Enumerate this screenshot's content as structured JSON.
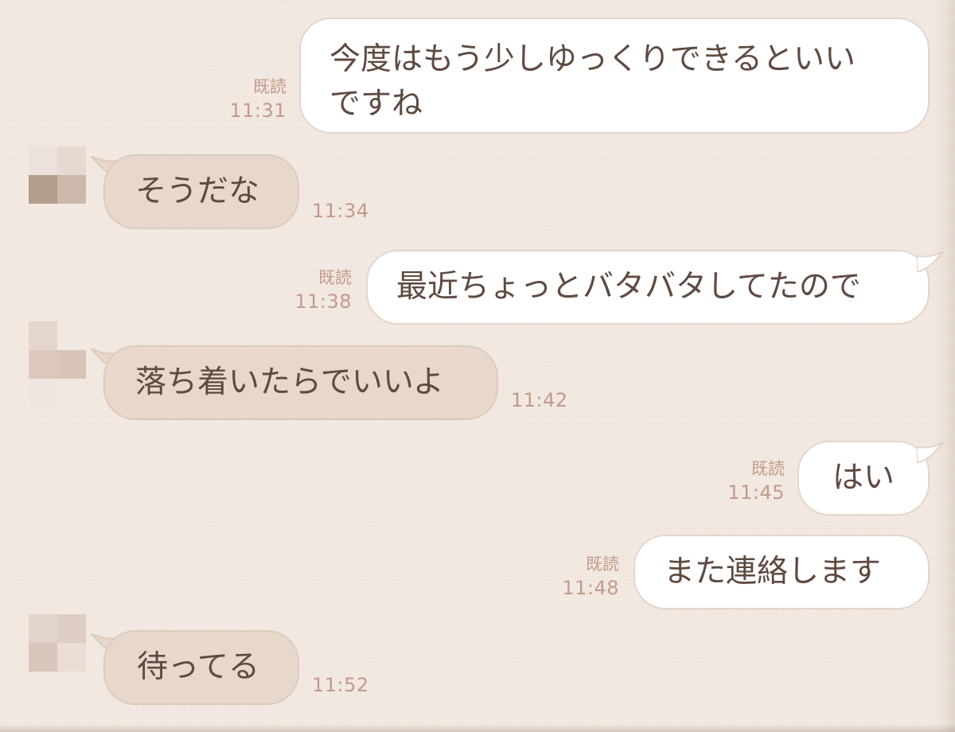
{
  "messages": [
    {
      "direction": "out",
      "text_lines": [
        "今度はもう少しゆっくりできるといい",
        "ですね"
      ],
      "read": "既読",
      "time": "11:31"
    },
    {
      "direction": "in",
      "text": "そうだな",
      "time": "11:34"
    },
    {
      "direction": "out",
      "text": "最近ちょっとバタバタしてたので",
      "read": "既読",
      "time": "11:38"
    },
    {
      "direction": "in",
      "text": "落ち着いたらでいいよ",
      "time": "11:42"
    },
    {
      "direction": "out",
      "text": "はい",
      "read": "既読",
      "time": "11:45"
    },
    {
      "direction": "out",
      "text": "また連絡します",
      "read": "既読",
      "time": "11:48"
    },
    {
      "direction": "in",
      "text": "待ってる",
      "time": "11:52"
    }
  ],
  "colors": {
    "background": "#f3ebe4",
    "outgoing_bubble": "#ffffff",
    "incoming_bubble": "#e8d8cc",
    "meta_text": "#c4998a",
    "message_text": "#5e4a40"
  }
}
